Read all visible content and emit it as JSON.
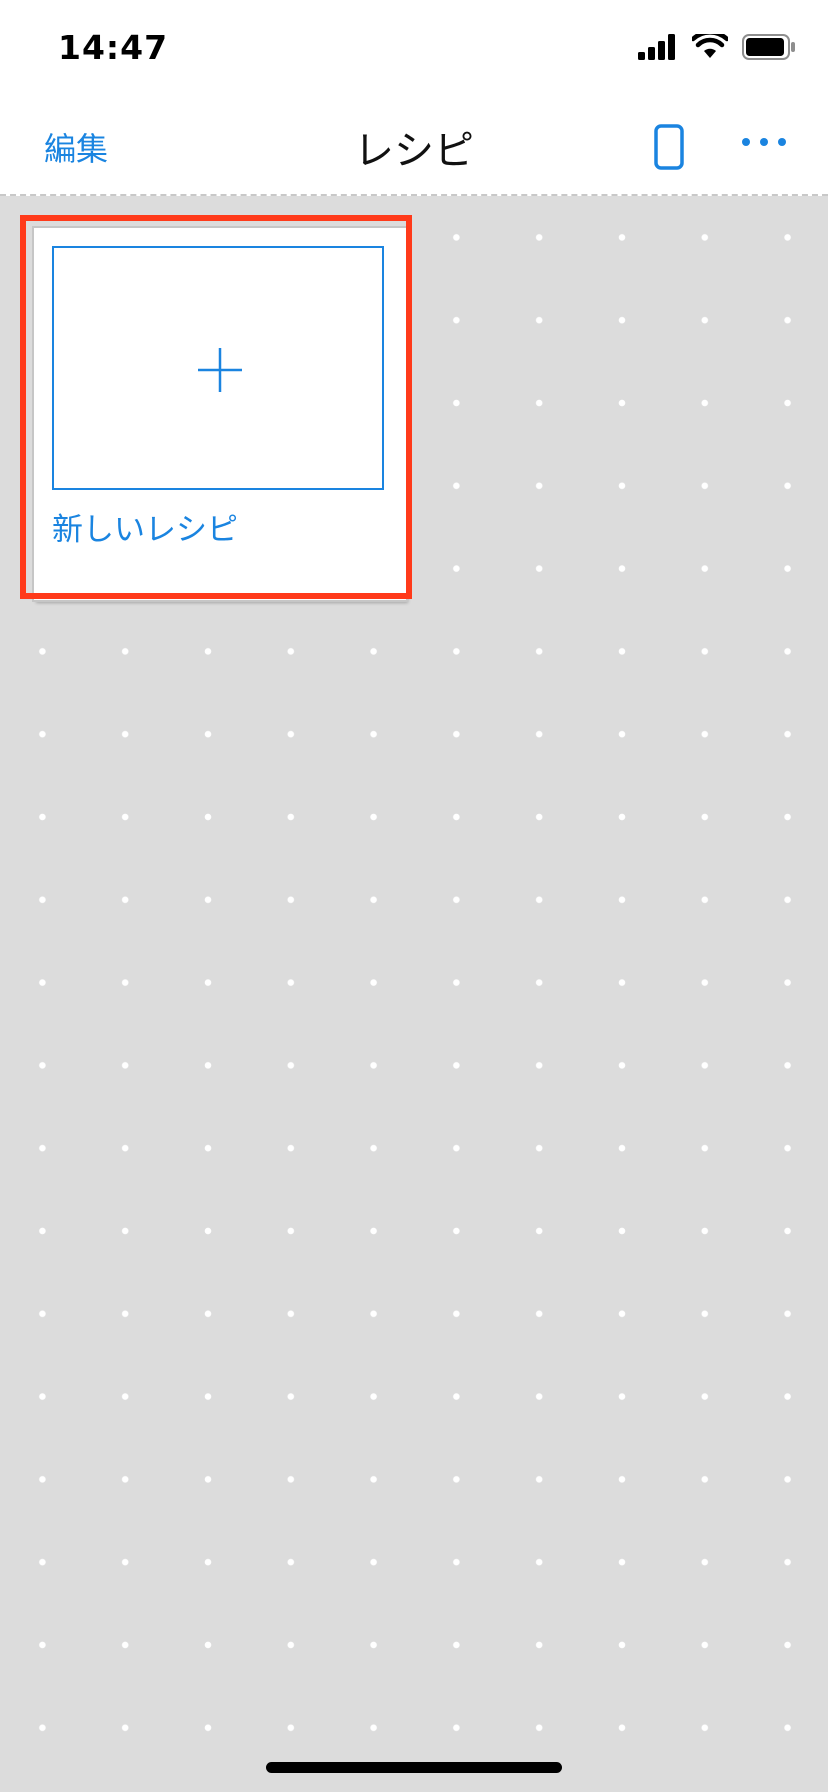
{
  "status_bar": {
    "time": "14:47"
  },
  "nav": {
    "edit_label": "編集",
    "title": "レシピ"
  },
  "card": {
    "label": "新しいレシピ"
  },
  "colors": {
    "accent": "#1a84e0",
    "highlight": "#ff3a1a",
    "background": "#dcdcdc"
  },
  "icons": {
    "signal": "cellular-signal-icon",
    "wifi": "wifi-icon",
    "battery": "battery-icon",
    "device": "phone-icon",
    "more": "more-dots-icon",
    "add": "plus-icon"
  }
}
